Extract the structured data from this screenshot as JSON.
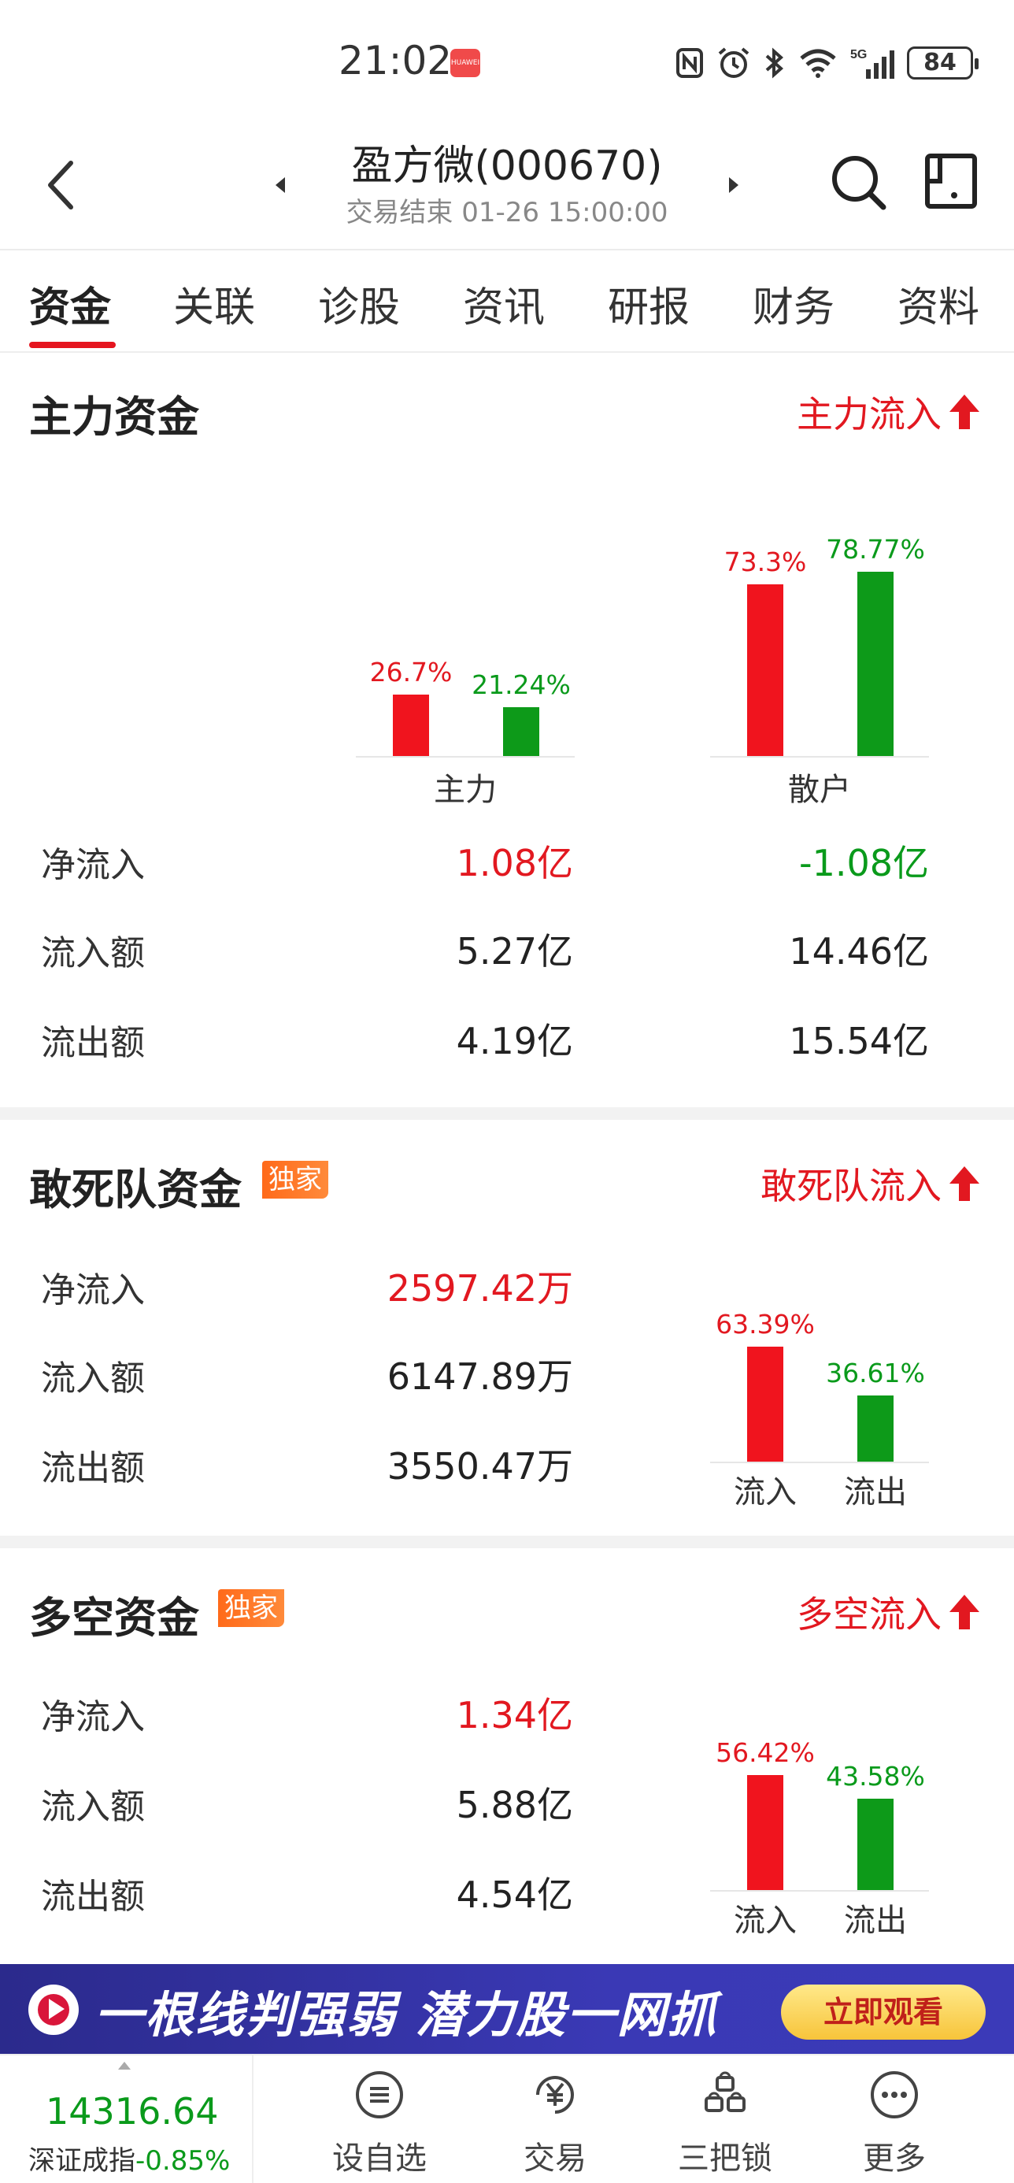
{
  "status_bar": {
    "time": "21:02",
    "app_icon_text": "HUAWEI",
    "network": "5G",
    "battery": "84"
  },
  "header": {
    "title": "盈方微(000670)",
    "subtitle": "交易结束 01-26 15:00:00",
    "icons": [
      "back-icon",
      "prev-arrow-icon",
      "next-arrow-icon",
      "search-icon",
      "layout-icon"
    ]
  },
  "tabs": [
    "资金",
    "关联",
    "诊股",
    "资讯",
    "研报",
    "财务",
    "资料"
  ],
  "main_fund": {
    "title": "主力资金",
    "link": "主力流入",
    "bars": {
      "main": {
        "label": "主力",
        "in_pct": "26.7%",
        "out_pct": "21.24%",
        "in_value": 26.7,
        "out_value": 21.24
      },
      "retail": {
        "label": "散户",
        "in_pct": "73.3%",
        "out_pct": "78.77%",
        "in_value": 73.3,
        "out_value": 78.77
      }
    },
    "rows": [
      {
        "label": "净流入",
        "main": "1.08亿",
        "retail": "-1.08亿"
      },
      {
        "label": "流入额",
        "main": "5.27亿",
        "retail": "14.46亿"
      },
      {
        "label": "流出额",
        "main": "4.19亿",
        "retail": "15.54亿"
      }
    ]
  },
  "daredevil": {
    "title": "敢死队资金",
    "badge": "独家",
    "link": "敢死队流入",
    "rows": [
      {
        "label": "净流入",
        "value": "2597.42万"
      },
      {
        "label": "流入额",
        "value": "6147.89万"
      },
      {
        "label": "流出额",
        "value": "3550.47万"
      }
    ],
    "bars": {
      "in_pct": "63.39%",
      "out_pct": "36.61%",
      "in_value": 63.39,
      "out_value": 36.61,
      "in_label": "流入",
      "out_label": "流出"
    }
  },
  "longshort": {
    "title": "多空资金",
    "badge": "独家",
    "link": "多空流入",
    "rows": [
      {
        "label": "净流入",
        "value": "1.34亿"
      },
      {
        "label": "流入额",
        "value": "5.88亿"
      },
      {
        "label": "流出额",
        "value": "4.54亿"
      }
    ],
    "bars": {
      "in_pct": "56.42%",
      "out_pct": "43.58%",
      "in_value": 56.42,
      "out_value": 43.58,
      "in_label": "流入",
      "out_label": "流出"
    }
  },
  "banner": {
    "text": "一根线判强弱 潜力股一网抓",
    "button": "立即观看"
  },
  "bottom_nav": {
    "index_value": "14316.64",
    "index_name": "深证成指",
    "index_change": "-0.85%",
    "items": [
      {
        "label": "设自选",
        "icon": "menu-list-icon"
      },
      {
        "label": "交易",
        "icon": "yuan-icon"
      },
      {
        "label": "三把锁",
        "icon": "locks-icon"
      },
      {
        "label": "更多",
        "icon": "more-icon"
      }
    ]
  },
  "colors": {
    "red": "#e21820",
    "green": "#0a9a1b",
    "banner": "#3a39b5"
  }
}
